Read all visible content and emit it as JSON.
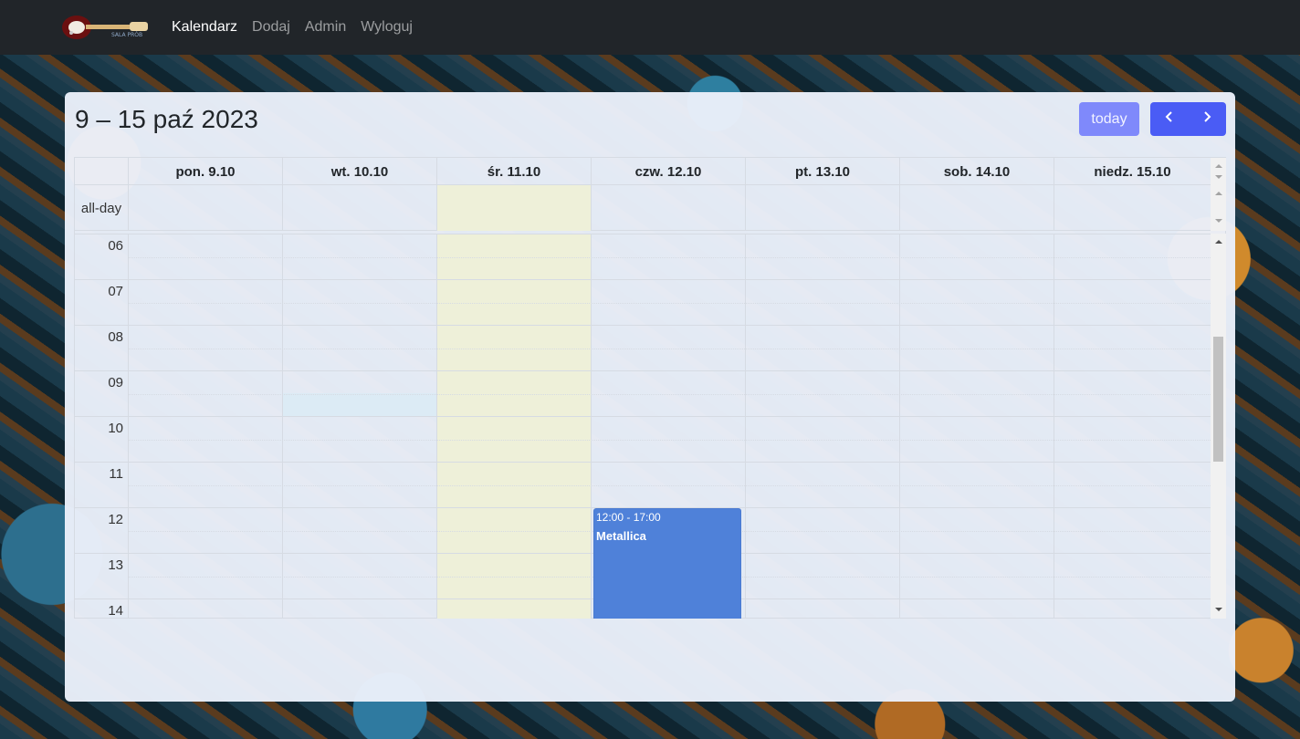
{
  "nav": {
    "logo_text": "SALA PRÓB",
    "links": [
      "Kalendarz",
      "Dodaj",
      "Admin",
      "Wyloguj"
    ],
    "active": "Kalendarz"
  },
  "calendar": {
    "title": "9 – 15 paź 2023",
    "today_button": "today",
    "prev_icon": "chevron-left-icon",
    "next_icon": "chevron-right-icon",
    "days": [
      "pon. 9.10",
      "wt. 10.10",
      "śr. 11.10",
      "czw. 12.10",
      "pt. 13.10",
      "sob. 14.10",
      "niedz. 15.10"
    ],
    "today_index": 2,
    "allday_label": "all-day",
    "hours": [
      "06",
      "07",
      "08",
      "09",
      "10",
      "11",
      "12",
      "13",
      "14"
    ],
    "events": [
      {
        "time": "12:00 - 17:00",
        "title": "Metallica",
        "day_index": 3,
        "color": "#4f81d9"
      }
    ]
  },
  "colors": {
    "navbar": "#212529",
    "accent": "#4a5cf5",
    "today_button": "#7f89fb",
    "today_highlight": "#eef0d9",
    "event": "#4f81d9"
  }
}
